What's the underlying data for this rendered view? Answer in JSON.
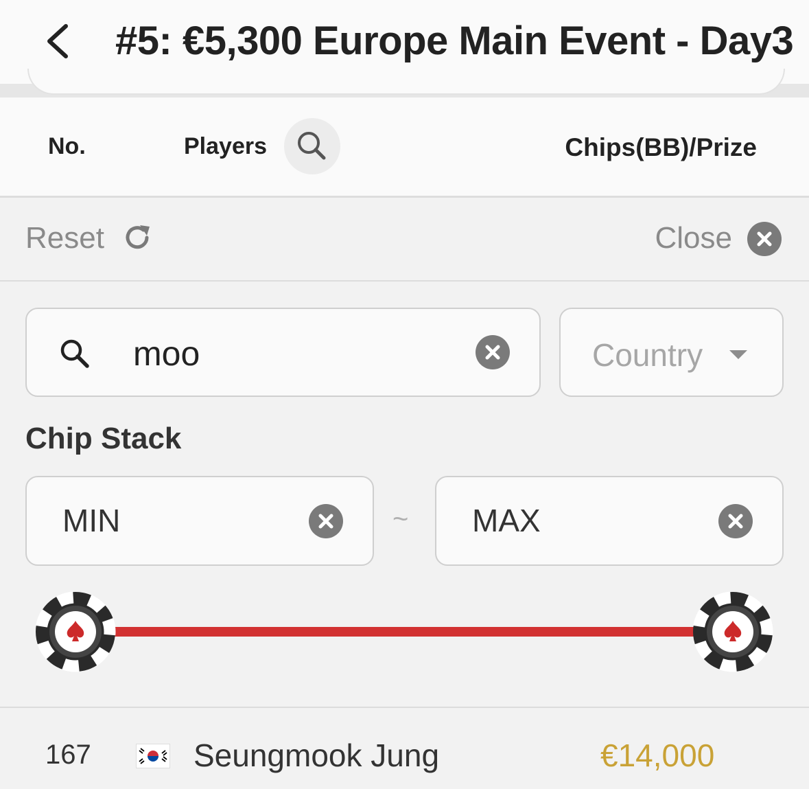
{
  "header": {
    "title": "#5: €5,300 Europe Main Event - Day3"
  },
  "columns": {
    "no": "No.",
    "players": "Players",
    "chips_prize": "Chips(BB)/Prize"
  },
  "filter_bar": {
    "reset_label": "Reset",
    "close_label": "Close"
  },
  "search": {
    "value": "moo",
    "country_placeholder": "Country"
  },
  "chip_stack": {
    "label": "Chip Stack",
    "min_placeholder": "MIN",
    "max_placeholder": "MAX",
    "separator": "~"
  },
  "results": [
    {
      "no": "167",
      "country": "South Korea",
      "name": "Seungmook Jung",
      "prize": "€14,000"
    }
  ],
  "colors": {
    "accent_red": "#d23232",
    "prize_gold": "#c9a236"
  }
}
